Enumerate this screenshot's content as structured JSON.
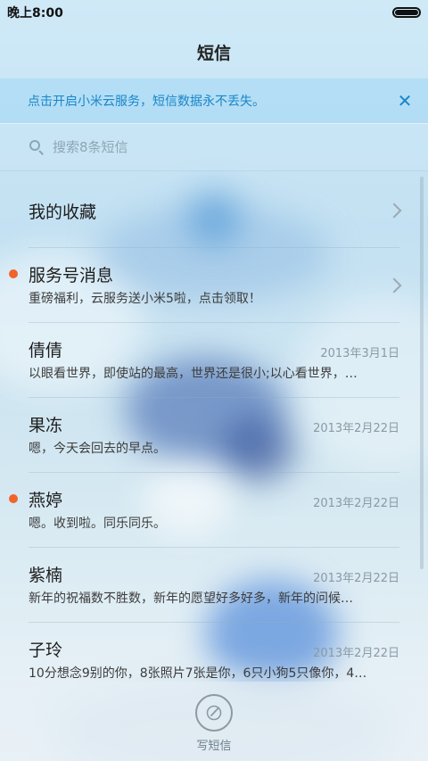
{
  "status_bar": {
    "time": "晚上8:00"
  },
  "header": {
    "title": "短信"
  },
  "banner": {
    "text": "点击开启小米云服务，短信数据永不丢失。",
    "close_icon": "close-icon"
  },
  "search": {
    "placeholder": "搜索8条短信",
    "value": ""
  },
  "list": {
    "favorites": {
      "name": "我的收藏"
    },
    "service": {
      "name": "服务号消息",
      "preview": "重磅福利，云服务送小米5啦，点击领取！",
      "unread": true
    },
    "conversations": [
      {
        "name": "倩倩",
        "date": "2013年3月1日",
        "preview": "以眼看世界，即使站的最高，世界还是很小;以心看世界，…",
        "unread": false
      },
      {
        "name": "果冻",
        "date": "2013年2月22日",
        "preview": "嗯，今天会回去的早点。",
        "unread": false
      },
      {
        "name": "燕婷",
        "date": "2013年2月22日",
        "preview": "嗯。收到啦。同乐同乐。",
        "unread": true
      },
      {
        "name": "紫楠",
        "date": "2013年2月22日",
        "preview": "新年的祝福数不胜数，新年的愿望好多好多，新年的问候…",
        "unread": false
      },
      {
        "name": "子玲",
        "date": "2013年2月22日",
        "preview": "10分想念9别的你，8张照片7张是你，6只小狗5只像你，4…",
        "unread": false
      }
    ]
  },
  "bottom": {
    "compose_label": "写短信",
    "compose_icon": "compose-icon"
  },
  "colors": {
    "accent": "#1a86c9",
    "unread_dot": "#f0642a"
  }
}
